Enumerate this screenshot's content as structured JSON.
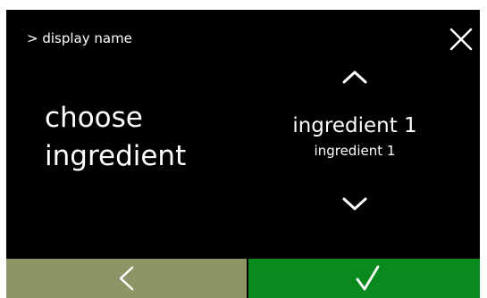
{
  "header": {
    "breadcrumb": "> display name"
  },
  "prompt": {
    "line1": "choose",
    "line2": "ingredient"
  },
  "picker": {
    "value": "ingredient 1",
    "subtitle": "ingredient 1"
  },
  "icons": {
    "close": "close-icon",
    "up": "chevron-up-icon",
    "down": "chevron-down-icon",
    "back": "chevron-left-icon",
    "confirm": "checkmark-icon"
  },
  "colors": {
    "background": "#000000",
    "text": "#ffffff",
    "back_button": "#8f9466",
    "confirm_button": "#0a8a1e"
  }
}
